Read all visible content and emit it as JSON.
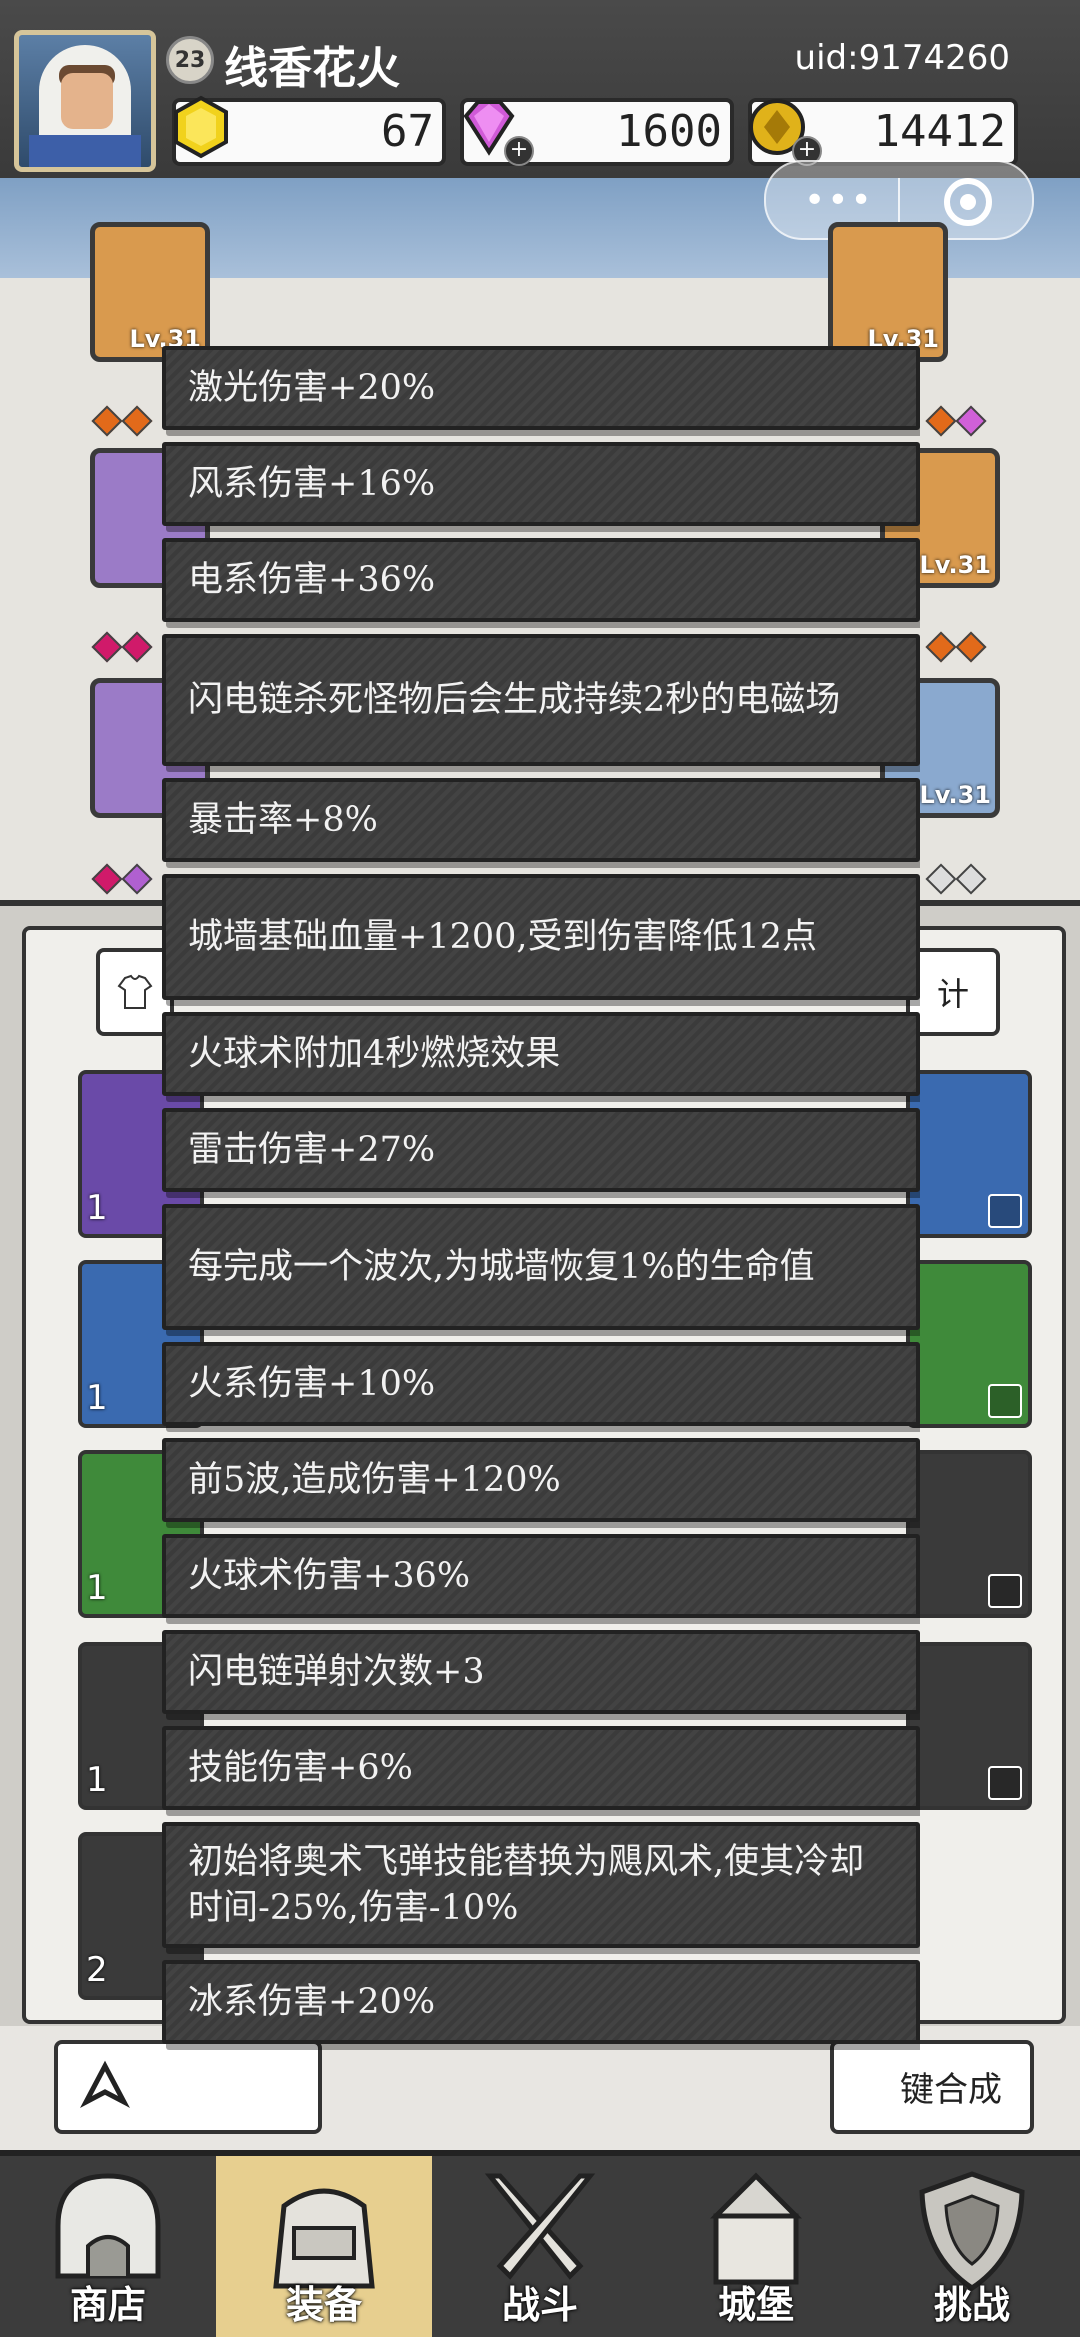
{
  "player": {
    "level": "23",
    "name": "线香花火",
    "uid": "uid:9174260"
  },
  "resources": {
    "gold_gem": "67",
    "diamond": "1600",
    "coin": "14412"
  },
  "equipment": {
    "levels": [
      "Lv.31",
      "Lv.31",
      "Lv.31",
      "Lv.31"
    ]
  },
  "bag": {
    "stats_button_fragment": "计",
    "tile_counts": [
      "1",
      "1",
      "1",
      "1",
      "2"
    ],
    "merge_button_fragment": "键合成"
  },
  "popup_items": [
    "激光伤害+20%",
    "风系伤害+16%",
    "电系伤害+36%",
    "闪电链杀死怪物后会生成持续2秒的电磁场",
    "暴击率+8%",
    "城墙基础血量+1200,受到伤害降低12点",
    "火球术附加4秒燃烧效果",
    "雷击伤害+27%",
    "每完成一个波次,为城墙恢复1%的生命值",
    "火系伤害+10%",
    "前5波,造成伤害+120%",
    "火球术伤害+36%",
    "闪电链弹射次数+3",
    "技能伤害+6%",
    "初始将奥术飞弹技能替换为飓风术,使其冷却时间-25%,伤害-10%",
    "冰系伤害+20%"
  ],
  "nav": [
    {
      "label": "商店",
      "icon": "shop-icon"
    },
    {
      "label": "装备",
      "icon": "bag-icon"
    },
    {
      "label": "战斗",
      "icon": "crossed-swords-icon"
    },
    {
      "label": "城堡",
      "icon": "castle-icon"
    },
    {
      "label": "挑战",
      "icon": "shield-icon"
    }
  ],
  "colors": {
    "nav_active": "#e7cf8f",
    "card_bg": "#3b3b3b",
    "header_bg": "#3a3a3a"
  }
}
